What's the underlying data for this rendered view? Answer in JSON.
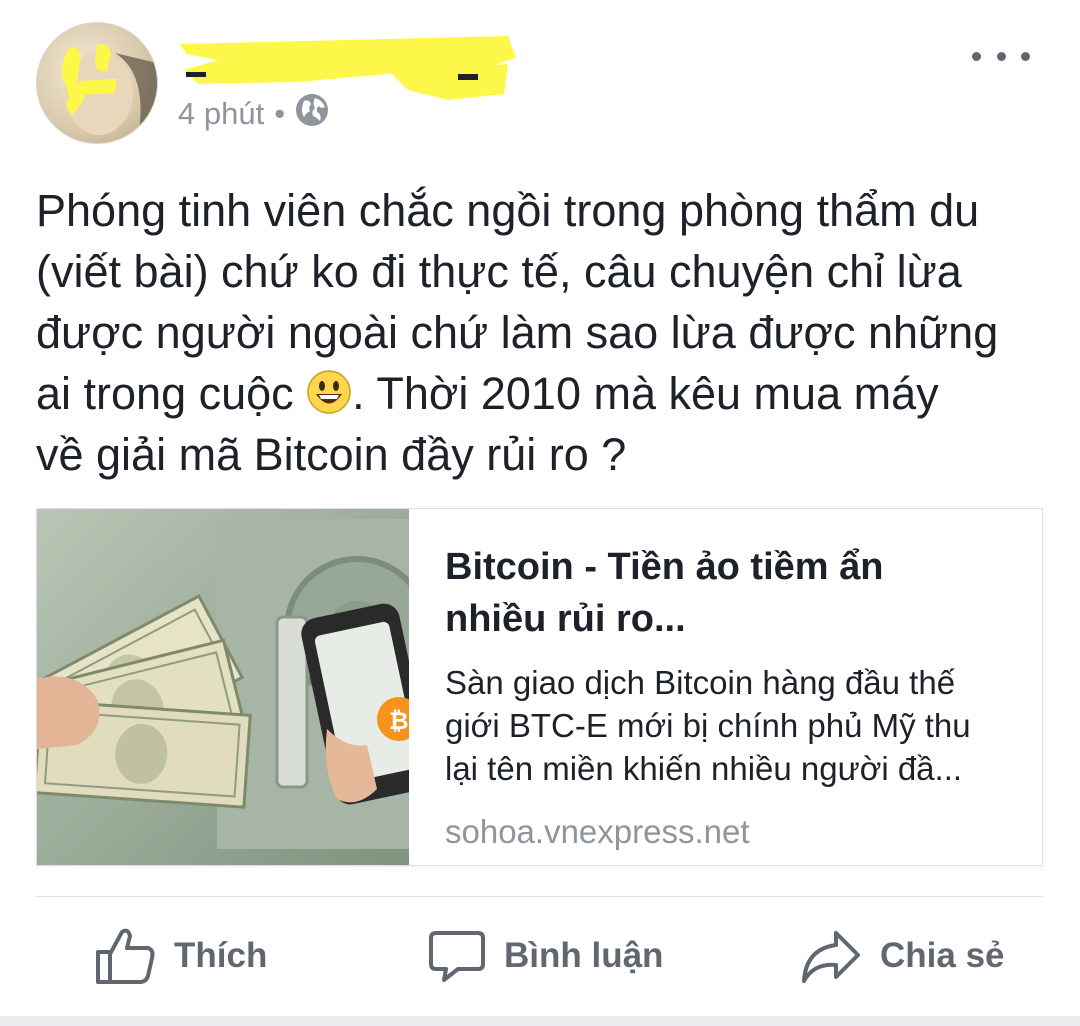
{
  "post": {
    "author": {
      "name": ""
    },
    "meta": {
      "time": "4 phút",
      "separator": "•",
      "audience_icon": "globe-icon"
    },
    "more_icon": "more-icon",
    "text_lines": [
      "Phóng tinh viên chắc ngồi trong phòng thẩm du",
      "(viết bài) chứ ko đi thực tế, câu chuyện chỉ lừa",
      "được người ngoài chứ làm sao lừa được những"
    ],
    "text_line4_before": "ai trong cuộc ",
    "emoji": "smiley-emoji",
    "text_line4_after": ". Thời 2010 mà kêu mua máy",
    "text_line5": "về giải mã Bitcoin đầy rủi ro ?"
  },
  "link_card": {
    "title_lines": [
      "Bitcoin - Tiền ảo tiềm ẩn",
      "nhiều rủi ro..."
    ],
    "description_lines": [
      "Sàn giao dịch Bitcoin hàng đầu thế",
      "giới BTC-E mới bị chính phủ Mỹ thu",
      "lại tên miền khiến nhiều người đầ..."
    ],
    "domain": "sohoa.vnexpress.net"
  },
  "actions": {
    "like": {
      "label": "Thích",
      "icon": "like-icon"
    },
    "comment": {
      "label": "Bình luận",
      "icon": "comment-icon"
    },
    "share": {
      "label": "Chia sẻ",
      "icon": "share-icon"
    }
  },
  "colors": {
    "text": "#1d2129",
    "secondary": "#90949c",
    "action": "#616770",
    "highlight": "#fdf74a",
    "bitcoin": "#f7931a"
  }
}
